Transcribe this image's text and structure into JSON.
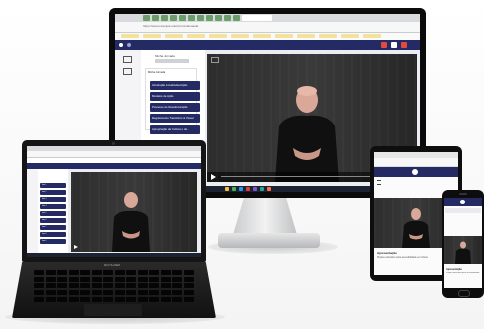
{
  "monitor": {
    "url": "https://www.example.edu/curso/videoaula",
    "panel_title": "Minha Jornada",
    "menu": [
      "Introdução à Audiodescrição",
      "Modelos de Ação",
      "Processo de Reestruturação",
      "Regulamento Transitório & Visual",
      "Apropriação da Cultura e da..."
    ]
  },
  "laptop": {
    "brand": "MULTILASER",
    "menu": [
      "Item 1",
      "Item 2",
      "Item 3",
      "Item 4",
      "Item 5",
      "Item 6",
      "Item 7",
      "Item 8",
      "Item 9"
    ]
  },
  "tablet": {
    "caption_title": "Apresentação",
    "caption_text": "Projeto educativo para acessibilidade em Libras"
  },
  "phone": {
    "caption_title": "Apresentação",
    "caption_text": "Projeto educativo para acessibilidade em Libras"
  },
  "colors": {
    "brand_navy": "#242a63",
    "video_bg": "#2d2d2d",
    "play_icon": "#ffffff"
  },
  "icons": [
    "play-icon",
    "volume-icon",
    "fullscreen-icon",
    "close-icon",
    "hamburger-icon",
    "user-avatar-icon"
  ]
}
